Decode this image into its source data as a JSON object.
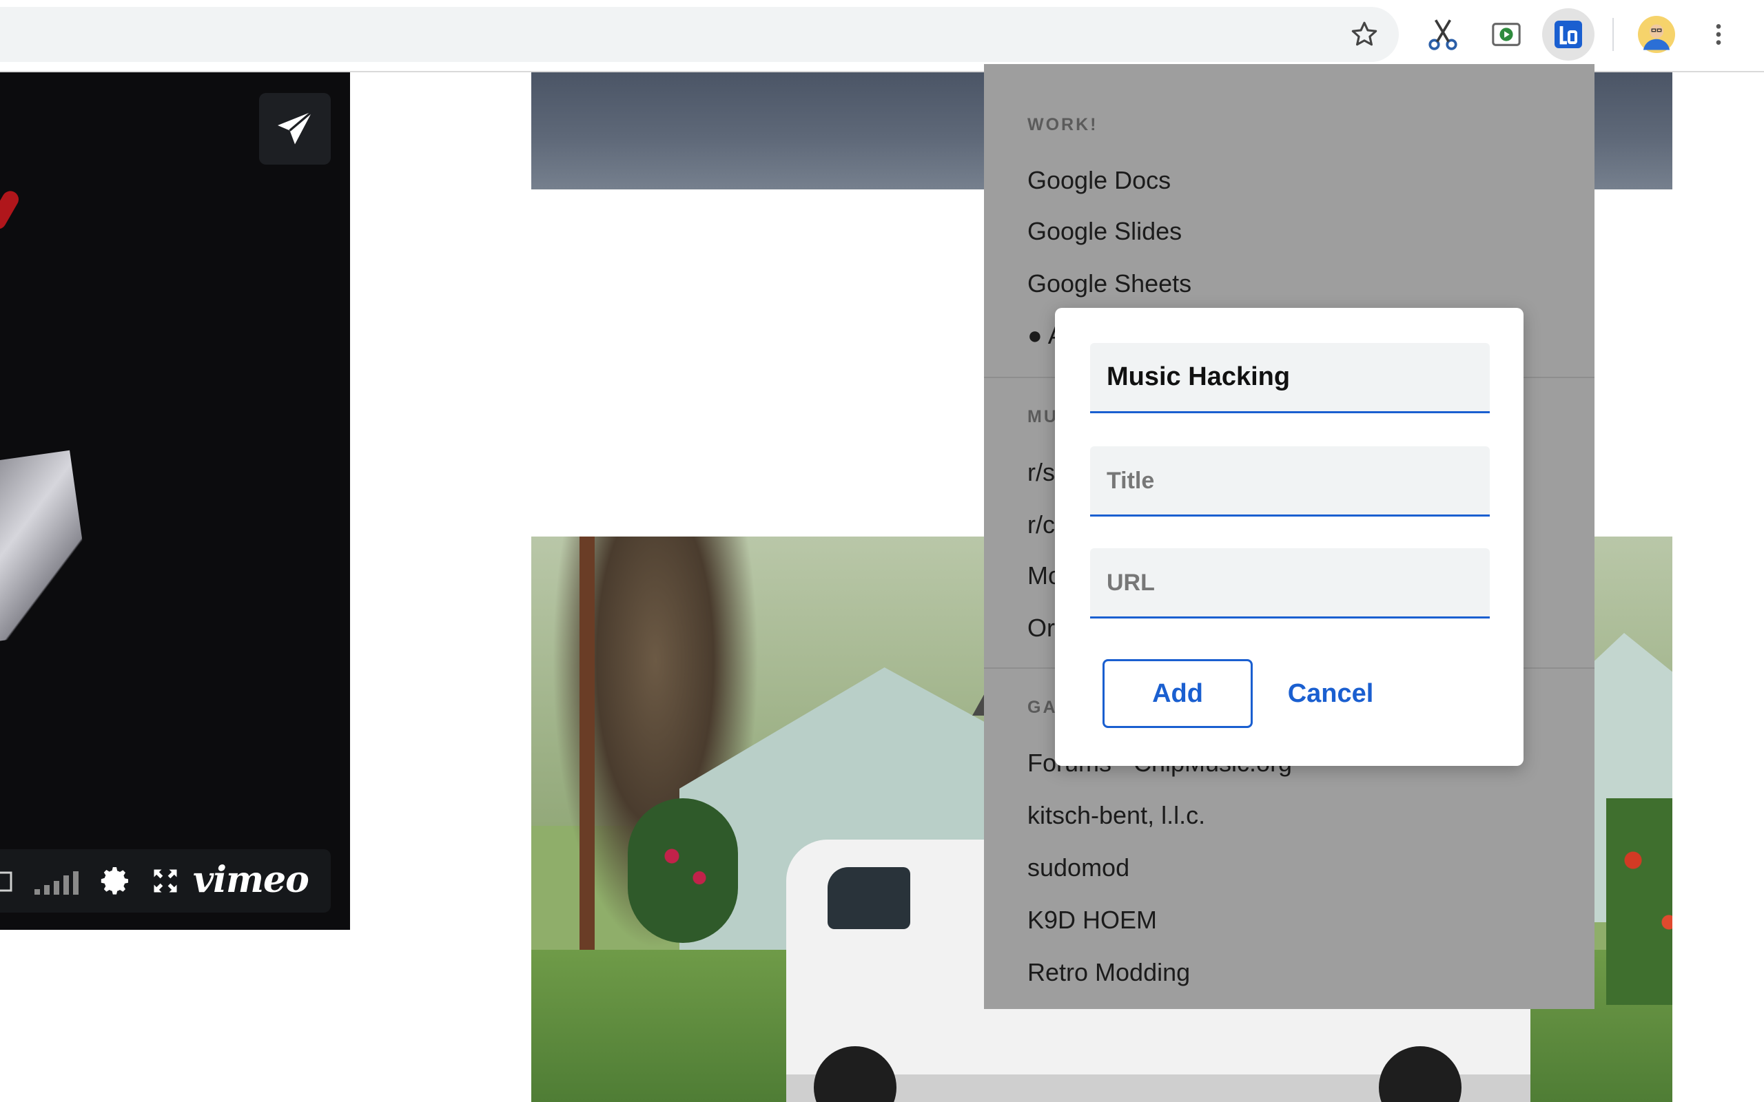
{
  "toolbar": {
    "icons": [
      "star-icon",
      "scissors-icon",
      "cast-media-icon",
      "bookmark-extension-icon",
      "avatar",
      "more-menu-icon"
    ],
    "accent": "#1a5fd0"
  },
  "video": {
    "logo": "vimeo",
    "controls": [
      "stop-icon",
      "volume-bars-icon",
      "settings-gear-icon",
      "fullscreen-icon"
    ]
  },
  "popup": {
    "sections": [
      {
        "label": "WORK!",
        "items": [
          "Google Docs",
          "Google Slides",
          "Google Sheets",
          "● A"
        ]
      },
      {
        "label": "MU",
        "items": [
          "r/s",
          "r/c",
          "Mo",
          "Or"
        ]
      },
      {
        "label": "GA",
        "items": [
          "Forums - ChipMusic.org",
          "kitsch-bent, l.l.c.",
          "sudomod",
          "K9D HOEM",
          "Retro Modding"
        ]
      }
    ]
  },
  "dialog": {
    "section_value": "Music Hacking",
    "title_placeholder": "Title",
    "url_placeholder": "URL",
    "add_label": "Add",
    "cancel_label": "Cancel"
  }
}
